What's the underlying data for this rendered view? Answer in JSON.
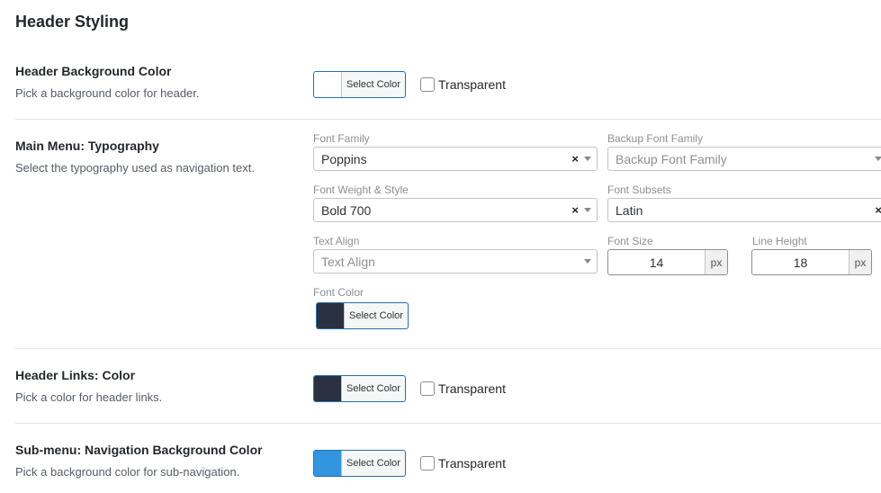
{
  "section": {
    "title": "Header Styling"
  },
  "rows": {
    "header_bg": {
      "label": "Header Background Color",
      "desc": "Pick a background color for header.",
      "color": "#ffffff",
      "button_label": "Select Color",
      "transparent_label": "Transparent"
    },
    "typography": {
      "label": "Main Menu: Typography",
      "desc": "Select the typography used as navigation text.",
      "font_family": {
        "label": "Font Family",
        "value": "Poppins"
      },
      "backup_font_family": {
        "label": "Backup Font Family",
        "placeholder": "Backup Font Family"
      },
      "font_weight": {
        "label": "Font Weight & Style",
        "value": "Bold 700"
      },
      "font_subsets": {
        "label": "Font Subsets",
        "value": "Latin"
      },
      "text_align": {
        "label": "Text Align",
        "placeholder": "Text Align"
      },
      "font_size": {
        "label": "Font Size",
        "value": "14",
        "unit": "px"
      },
      "line_height": {
        "label": "Line Height",
        "value": "18",
        "unit": "px"
      },
      "font_color": {
        "label": "Font Color",
        "color": "#2b3040",
        "button_label": "Select Color"
      }
    },
    "header_links": {
      "label": "Header Links: Color",
      "desc": "Pick a color for header links.",
      "color": "#2b3040",
      "button_label": "Select Color",
      "transparent_label": "Transparent"
    },
    "submenu_bg": {
      "label": "Sub-menu: Navigation Background Color",
      "desc": "Pick a background color for sub-navigation.",
      "color": "#3195e0",
      "button_label": "Select Color",
      "transparent_label": "Transparent"
    }
  },
  "icons": {
    "clear": "×"
  }
}
